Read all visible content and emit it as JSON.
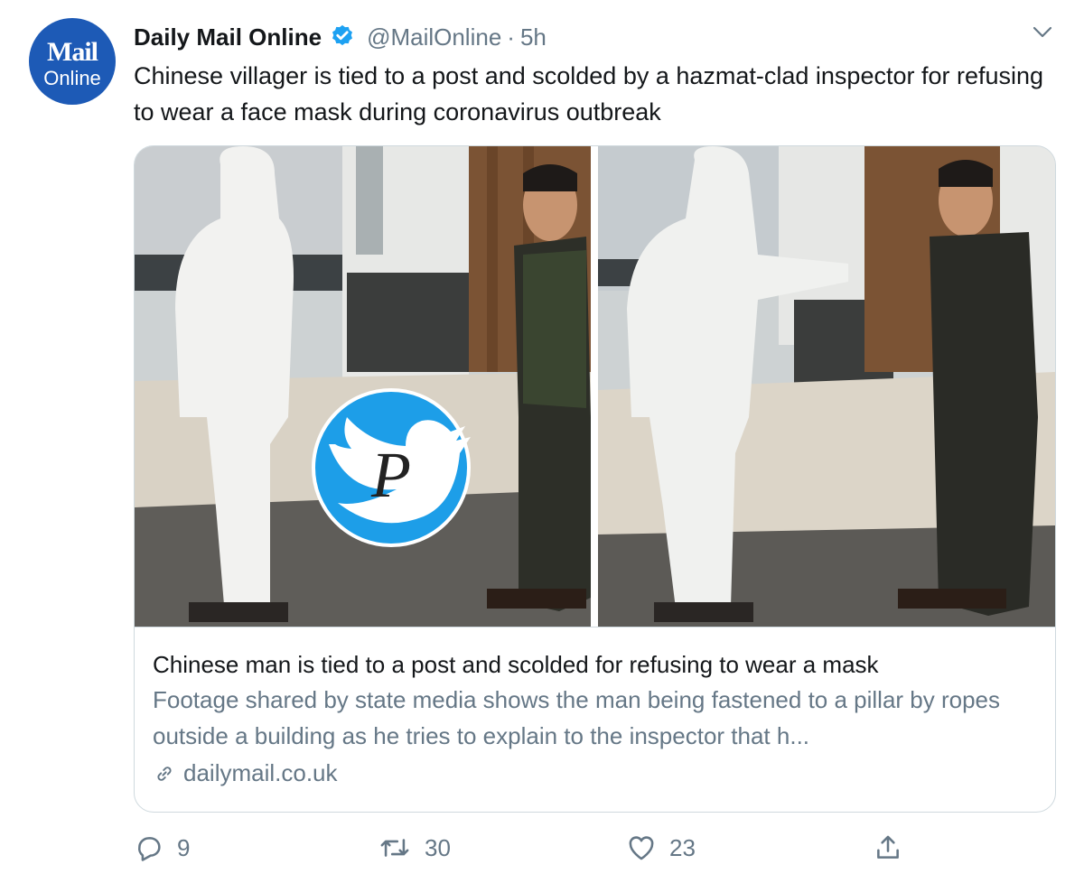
{
  "avatar": {
    "line1": "Mail",
    "line2": "Online"
  },
  "tweet": {
    "author_name": "Daily Mail Online",
    "handle": "@MailOnline",
    "separator": "·",
    "time": "5h",
    "text": "Chinese villager is tied to a post and scolded by a hazmat-clad inspector for refusing to wear a face mask during coronavirus outbreak"
  },
  "card": {
    "title": "Chinese man is tied to a post and scolded for refusing to wear a mask",
    "description": "Footage shared by state media shows the man being fastened to a pillar by ropes outside a building as he tries to explain to the inspector that h...",
    "domain": "dailymail.co.uk",
    "watermark_letter": "P"
  },
  "actions": {
    "reply_count": "9",
    "retweet_count": "30",
    "like_count": "23"
  },
  "icons": [
    "verified-badge-icon",
    "chevron-down-icon",
    "link-icon",
    "reply-icon",
    "retweet-icon",
    "like-icon",
    "share-icon",
    "twitter-bird-icon"
  ],
  "colors": {
    "avatar_bg": "#1d5ab6",
    "verified_blue": "#1da1f2",
    "text_primary": "#14171a",
    "text_secondary": "#657786",
    "card_border": "#cfd9de"
  }
}
